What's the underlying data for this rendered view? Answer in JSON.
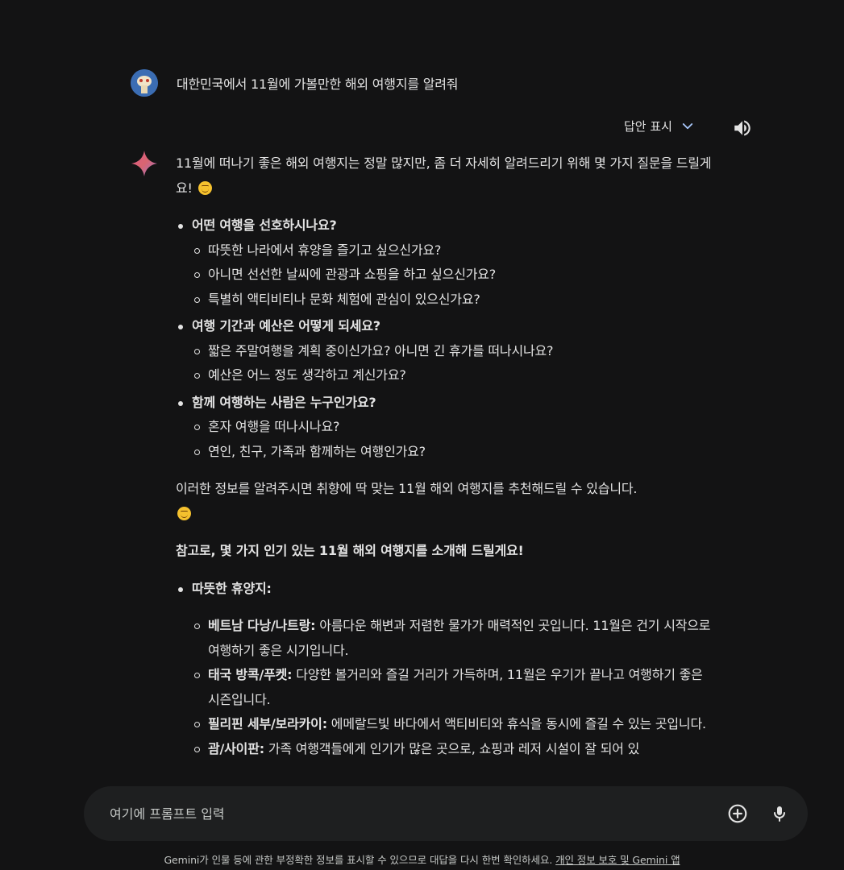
{
  "user_query": "대한민국에서 11월에 가볼만한 해외 여행지를 알려줘",
  "answer_controls": {
    "show_drafts_label": "답안 표시",
    "chevron_icon": "chevron-down-icon",
    "speaker_icon": "volume-icon"
  },
  "response": {
    "intro": "11월에 떠나기 좋은 해외 여행지는 정말 많지만, 좀 더 자세히 알려드리기 위해 몇 가지 질문을 드릴게요!",
    "questions": [
      {
        "title": "어떤 여행을 선호하시나요?",
        "items": [
          "따뜻한 나라에서 휴양을 즐기고 싶으신가요?",
          "아니면 선선한 날씨에 관광과 쇼핑을 하고 싶으신가요?",
          "특별히 액티비티나 문화 체험에 관심이 있으신가요?"
        ]
      },
      {
        "title": "여행 기간과 예산은 어떻게 되세요?",
        "items": [
          "짧은 주말여행을 계획 중이신가요? 아니면 긴 휴가를 떠나시나요?",
          "예산은 어느 정도 생각하고 계신가요?"
        ]
      },
      {
        "title": "함께 여행하는 사람은 누구인가요?",
        "items": [
          "혼자 여행을 떠나시나요?",
          "연인, 친구, 가족과 함께하는 여행인가요?"
        ]
      }
    ],
    "closing": "이러한 정보를 알려주시면 취향에 딱 맞는 11월 해외 여행지를 추천해드릴 수 있습니다.",
    "reference_heading": "참고로, 몇 가지 인기 있는 11월 해외 여행지를 소개해 드릴게요!",
    "category": {
      "title": "따뜻한 휴양지:",
      "destinations": [
        {
          "name": "베트남 다낭/나트랑:",
          "desc": "아름다운 해변과 저렴한 물가가 매력적인 곳입니다. 11월은 건기 시작으로 여행하기 좋은 시기입니다."
        },
        {
          "name": "태국 방콕/푸켓:",
          "desc": "다양한 볼거리와 즐길 거리가 가득하며, 11월은 우기가 끝나고 여행하기 좋은 시즌입니다."
        },
        {
          "name": "필리핀 세부/보라카이:",
          "desc": "에메랄드빛 바다에서 액티비티와 휴식을 동시에 즐길 수 있는 곳입니다."
        },
        {
          "name": "괌/사이판:",
          "desc": "가족 여행객들에게 인기가 많은 곳으로, 쇼핑과 레저 시설이 잘 되어 있"
        }
      ]
    }
  },
  "input": {
    "placeholder": "여기에 프롬프트 입력",
    "add_icon": "plus-circle-icon",
    "mic_icon": "mic-icon"
  },
  "footer": {
    "disclaimer": "Gemini가 인물 등에 관한 부정확한 정보를 표시할 수 있으므로 대답을 다시 한번 확인하세요.",
    "link": "개인 정보 보호 및 Gemini 앱"
  }
}
